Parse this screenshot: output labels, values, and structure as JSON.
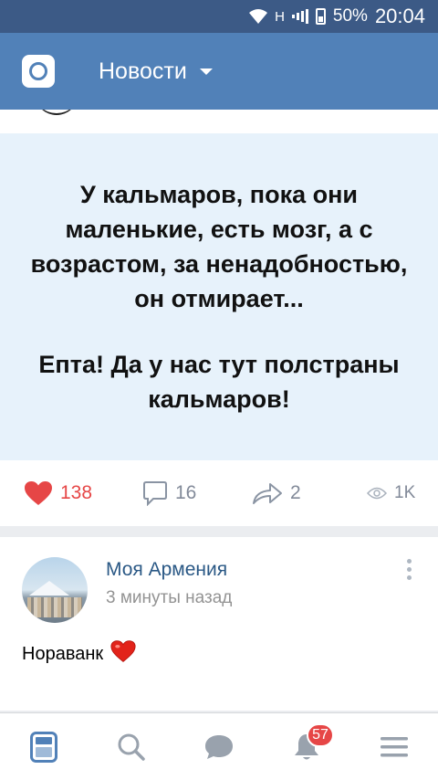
{
  "status_bar": {
    "network": "H",
    "battery": "50%",
    "time": "20:04"
  },
  "app_bar": {
    "title": "Новости",
    "camera_icon": "camera-icon",
    "dropdown_icon": "caret-down-icon"
  },
  "post1": {
    "meme_text_1": "У кальмаров, пока они маленькие, есть мозг, а с возрастом, за ненадобностью, он отмирает...",
    "meme_text_2": "Епта! Да у нас тут полстраны кальмаров!",
    "likes": "138",
    "comments": "16",
    "shares": "2",
    "views": "1K",
    "like_color": "#e64646"
  },
  "post2": {
    "author": "Моя Армения",
    "time": "3 минуты назад",
    "text": "Нораванк",
    "emoji": "❤️"
  },
  "bottom_nav": {
    "items": [
      "news-icon",
      "search-icon",
      "messages-icon",
      "notifications-icon",
      "menu-icon"
    ],
    "notifications_badge": "57",
    "active_color": "#5181b8"
  }
}
